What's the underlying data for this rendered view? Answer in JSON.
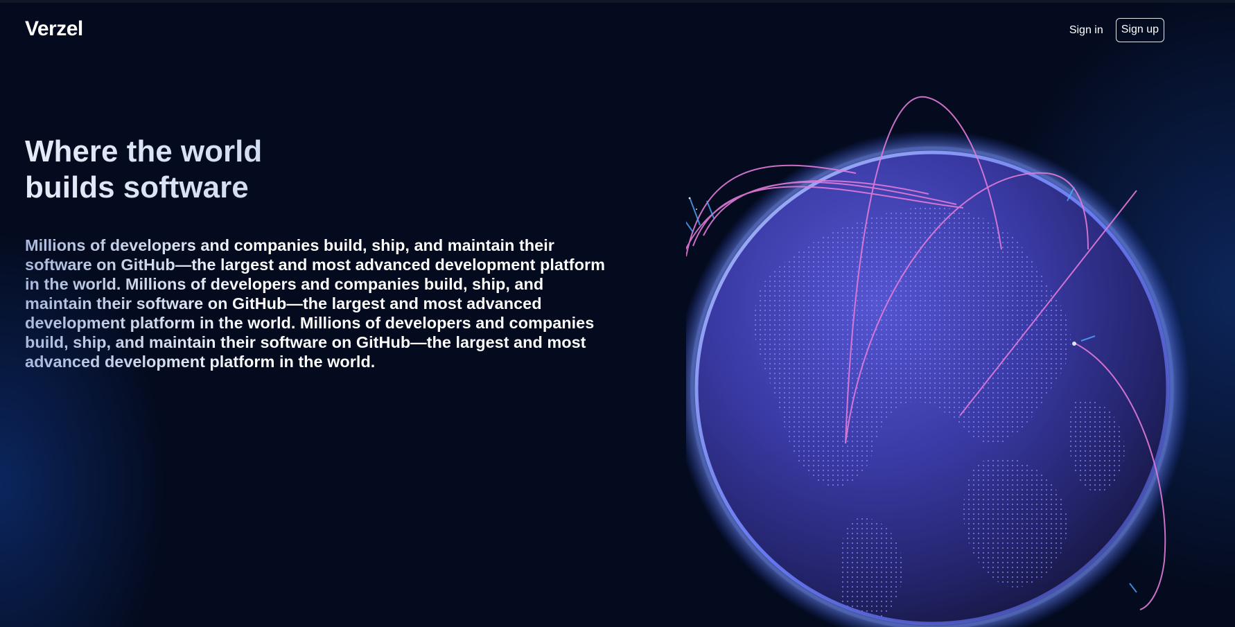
{
  "header": {
    "logo": "Verzel",
    "signin_label": "Sign in",
    "signup_label": "Sign up"
  },
  "hero": {
    "title": "Where the world builds software",
    "description": "Millions of developers and companies build, ship, and maintain their software on GitHub—the largest and most advanced development platform in the world. Millions of developers and companies build, ship, and maintain their software on GitHub—the largest and most advanced development platform in the world. Millions of developers and companies build, ship, and maintain their software on GitHub—the largest and most advanced development platform in the world."
  },
  "colors": {
    "background": "#040b1f",
    "globe": "#3b3fae",
    "globe_rim": "#6f8cff",
    "arc": "#e27bd9",
    "text": "#ffffff"
  }
}
